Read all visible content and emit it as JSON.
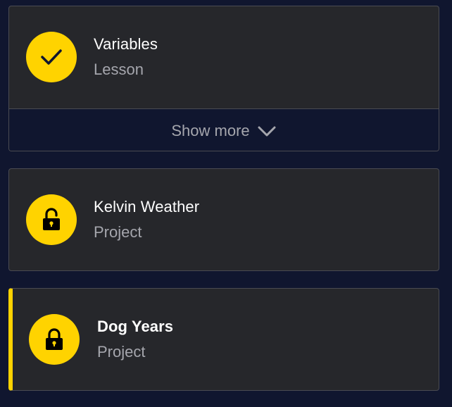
{
  "items": [
    {
      "title": "Variables",
      "subtitle": "Lesson",
      "status_icon": "checkmark-icon",
      "show_more_label": "Show more"
    },
    {
      "title": "Kelvin Weather",
      "subtitle": "Project",
      "status_icon": "unlocked-padlock-icon"
    },
    {
      "title": "Dog Years",
      "subtitle": "Project",
      "status_icon": "locked-padlock-icon",
      "active": true
    }
  ],
  "colors": {
    "background": "#10162f",
    "card": "#26272b",
    "accent": "#ffd300",
    "title": "#ffffff",
    "subtitle": "#a5a6ad"
  }
}
